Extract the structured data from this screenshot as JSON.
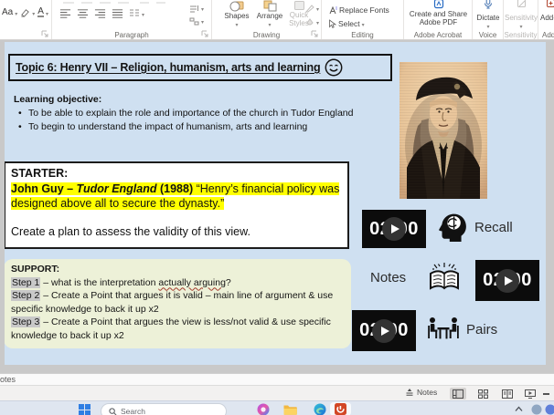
{
  "ribbon": {
    "font": {
      "change_case": "Aa",
      "font_color_letter": "A"
    },
    "paragraph": {
      "label": "Paragraph"
    },
    "drawing": {
      "label": "Drawing",
      "shapes": "Shapes",
      "arrange": "Arrange",
      "quick_styles_line1": "Quick",
      "quick_styles_line2": "Styles"
    },
    "editing": {
      "label": "Editing",
      "replace_fonts": "Replace Fonts",
      "select": "Select"
    },
    "acrobat": {
      "label": "Adobe Acrobat",
      "button_line1": "Create and Share",
      "button_line2": "Adobe PDF"
    },
    "voice": {
      "label": "Voice",
      "dictate": "Dictate"
    },
    "sensitivity": {
      "label": "Sensitivity",
      "button": "Sensitivity"
    },
    "addins": {
      "label": "Add-ins",
      "button": "Add-ins"
    }
  },
  "slide": {
    "title": {
      "text": "Topic 6: Henry VII – Religion, humanism, arts and learning"
    },
    "objective": {
      "heading": "Learning objective:",
      "bullets": [
        "To be able to explain the role and importance of the church in Tudor England",
        "To begin to understand the impact of humanism, arts and learning"
      ]
    },
    "starter": {
      "heading": "STARTER:",
      "author": "John Guy – ",
      "book": "Tudor England",
      "year": " (1988) ",
      "quote": "“Henry’s financial policy was designed above all to secure the dynasty.”",
      "task": "Create a plan to assess the validity of this view."
    },
    "support": {
      "heading": "SUPPORT:",
      "steps": [
        {
          "label": "Step 1",
          "pre": " – what is the interpretation ",
          "emphasis": "actually arguing",
          "post": "?"
        },
        {
          "label": "Step 2",
          "pre": " – Create a Point that argues it is valid – main line of argument & use specific knowledge to back it up x2",
          "emphasis": "",
          "post": ""
        },
        {
          "label": "Step 3",
          "pre": " – Create a Point that argues the view is less/not valid & use specific knowledge to back it up x2",
          "emphasis": "",
          "post": ""
        }
      ]
    },
    "activities": {
      "recall": {
        "label": "Recall",
        "timer": "02:00"
      },
      "notes": {
        "label": "Notes",
        "timer": "02:00"
      },
      "pairs": {
        "label": "Pairs",
        "timer": "02:00"
      }
    }
  },
  "notes_pane": {
    "text": "otes"
  },
  "status_bar": {
    "notes_button": "Notes"
  },
  "taskbar": {
    "search_placeholder": "Search"
  },
  "icons": {
    "play": "triangle-right",
    "caret": "▾",
    "smiley": "happy-face"
  },
  "colors": {
    "highlight": "#ffff00",
    "slide_bg": "#cfe0f1",
    "support_bg": "#edf1d8",
    "timer_bg": "#0c0c0c",
    "step_highlight": "#c8c8c8"
  }
}
